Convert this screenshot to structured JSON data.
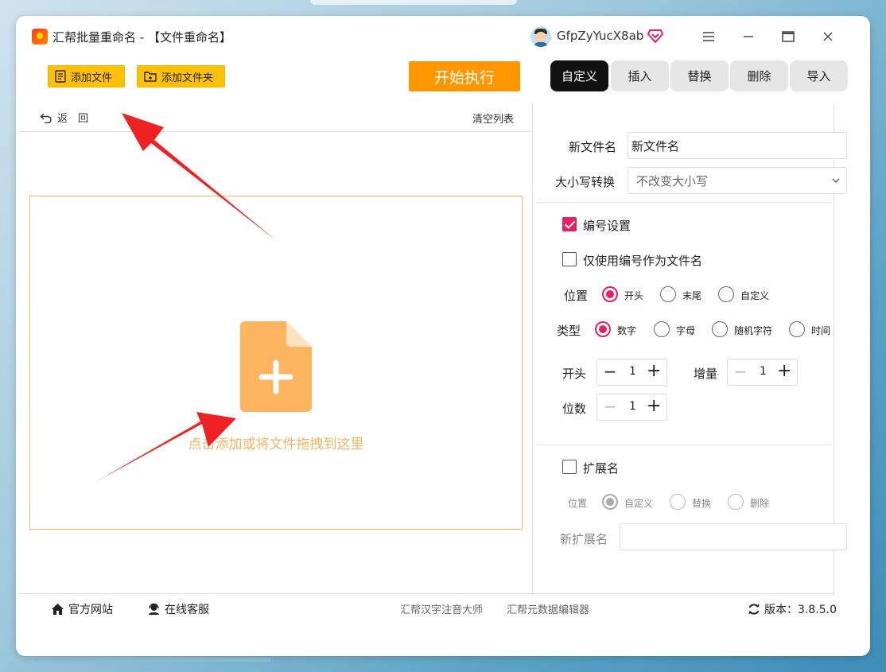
{
  "app": {
    "title": "汇帮批量重命名 - 【文件重命名】",
    "username": "GfpZyYucX8ab"
  },
  "toolbar": {
    "add_file": "添加文件",
    "add_folder": "添加文件夹",
    "start": "开始执行"
  },
  "tabs": [
    {
      "label": "自定义",
      "active": true
    },
    {
      "label": "插入",
      "active": false
    },
    {
      "label": "替换",
      "active": false
    },
    {
      "label": "删除",
      "active": false
    },
    {
      "label": "导入",
      "active": false
    }
  ],
  "list": {
    "back": "返　回",
    "clear": "清空列表",
    "drop_hint": "点击添加或将文件拖拽到这里"
  },
  "panel": {
    "new_name_label": "新文件名",
    "new_name_value": "新文件名",
    "case_label": "大小写转换",
    "case_value": "不改变大小写",
    "numbering": {
      "enabled_label": "编号设置",
      "enabled": true,
      "only_number_label": "仅使用编号作为文件名",
      "only_number": false,
      "position_label": "位置",
      "position_options": [
        "开头",
        "末尾",
        "自定义"
      ],
      "position_selected": "开头",
      "type_label": "类型",
      "type_options": [
        "数字",
        "字母",
        "随机字符",
        "时间"
      ],
      "type_selected": "数字",
      "start_label": "开头",
      "start_value": "1",
      "increment_label": "增量",
      "increment_value": "1",
      "digits_label": "位数",
      "digits_value": "1"
    },
    "extension": {
      "label": "扩展名",
      "enabled": false,
      "position_label": "位置",
      "options": [
        "自定义",
        "替换",
        "删除"
      ],
      "selected": "自定义",
      "new_ext_label": "新扩展名",
      "new_ext_value": ""
    }
  },
  "footer": {
    "website": "官方网站",
    "support": "在线客服",
    "link1": "汇帮汉字注音大师",
    "link2": "汇帮元数据编辑器",
    "version": "版本：3.8.5.0"
  },
  "colors": {
    "accent": "#e91e63",
    "toolbar_yellow": "#ffc107",
    "start_orange": "#ff9800",
    "drop_border": "#f3b66a",
    "drop_text": "#f7b460",
    "arrow_red": "#ee2222"
  }
}
